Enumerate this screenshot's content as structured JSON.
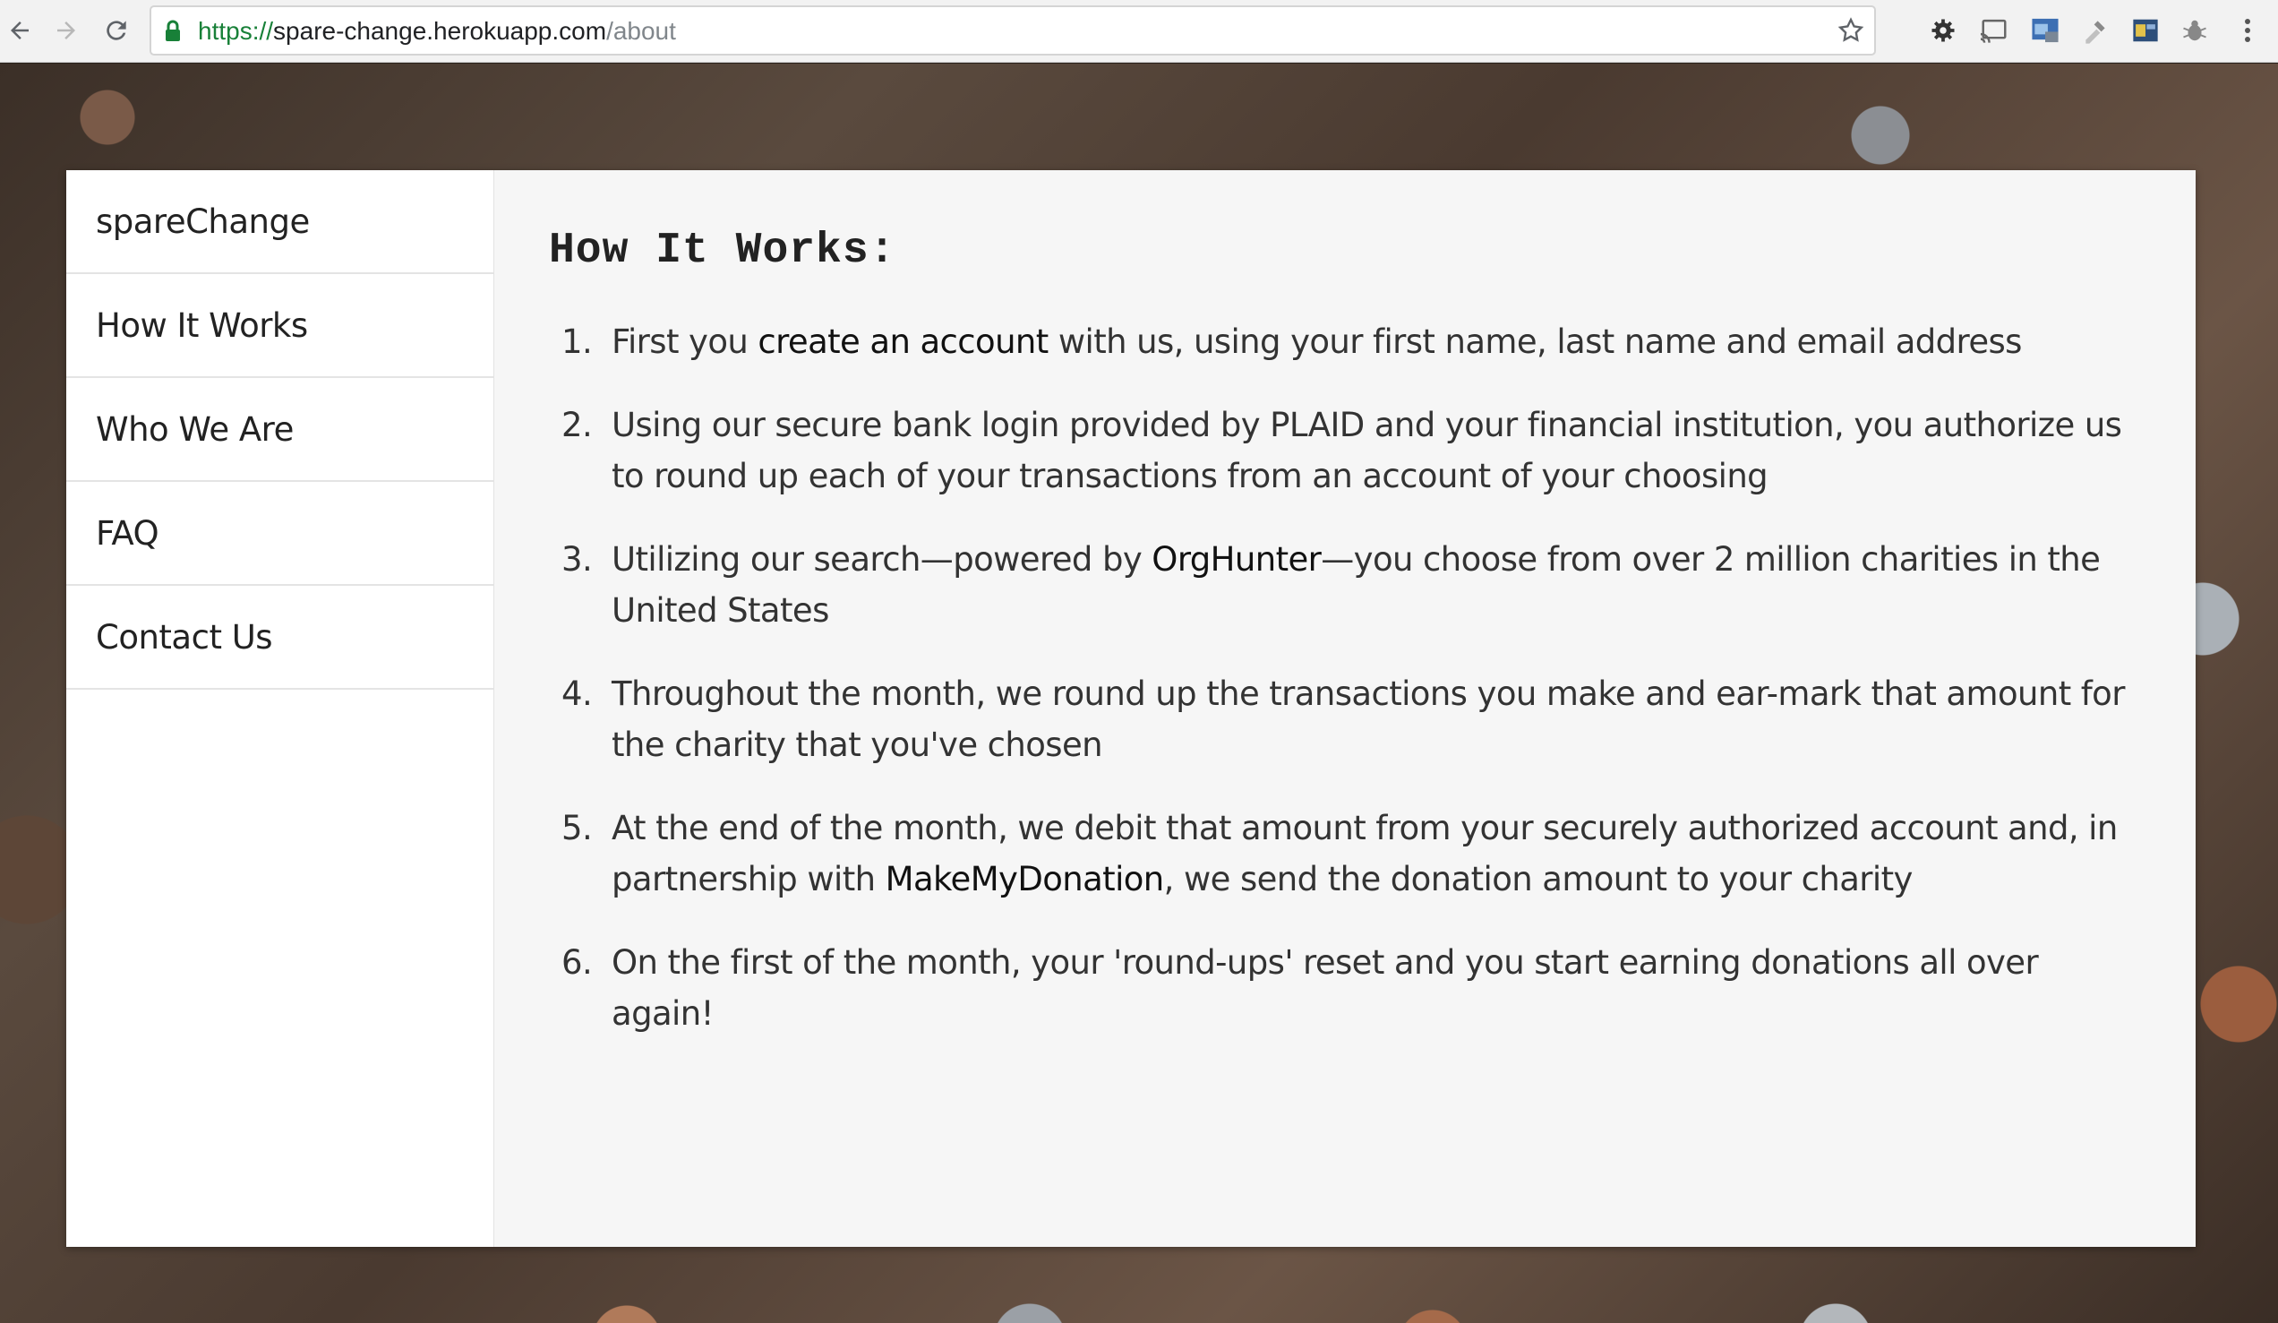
{
  "browser": {
    "url_scheme": "https://",
    "url_host": "spare-change.herokuapp.com",
    "url_path": "/about"
  },
  "sidebar": {
    "brand": "spareChange",
    "items": [
      {
        "label": "How It Works"
      },
      {
        "label": "Who We Are"
      },
      {
        "label": "FAQ"
      },
      {
        "label": "Contact Us"
      }
    ]
  },
  "main": {
    "heading": "How It Works:",
    "steps": [
      {
        "num": "1.",
        "a": "First you ",
        "link": "create an account",
        "b": " with us, using your first name, last name and email address"
      },
      {
        "num": "2.",
        "a": "Using our secure bank login provided by PLAID and your financial institution, you authorize us to round up each of your transactions from an account of your choosing"
      },
      {
        "num": "3.",
        "a": "Utilizing our search—powered by ",
        "link": "OrgHunter",
        "b": "—you choose from over 2 million charities in the United States"
      },
      {
        "num": "4.",
        "a": "Throughout the month, we round up the transactions you make and ear-mark that amount for the charity that you've chosen"
      },
      {
        "num": "5.",
        "a": "At the end of the month, we debit that amount from your securely authorized account and, in partnership with ",
        "link": "MakeMyDonation",
        "b": ", we send the donation amount to your charity"
      },
      {
        "num": "6.",
        "a": "On the first of the month, your 'round-ups' reset and you start earning donations all over again!"
      }
    ]
  }
}
